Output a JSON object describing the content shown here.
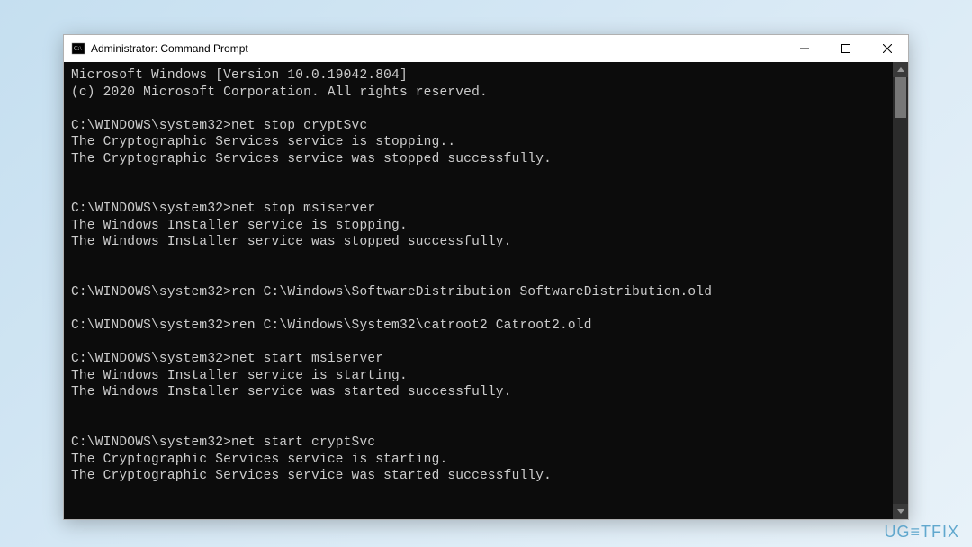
{
  "window": {
    "title": "Administrator: Command Prompt"
  },
  "console": {
    "lines": [
      "Microsoft Windows [Version 10.0.19042.804]",
      "(c) 2020 Microsoft Corporation. All rights reserved.",
      "",
      "C:\\WINDOWS\\system32>net stop cryptSvc",
      "The Cryptographic Services service is stopping..",
      "The Cryptographic Services service was stopped successfully.",
      "",
      "",
      "C:\\WINDOWS\\system32>net stop msiserver",
      "The Windows Installer service is stopping.",
      "The Windows Installer service was stopped successfully.",
      "",
      "",
      "C:\\WINDOWS\\system32>ren C:\\Windows\\SoftwareDistribution SoftwareDistribution.old",
      "",
      "C:\\WINDOWS\\system32>ren C:\\Windows\\System32\\catroot2 Catroot2.old",
      "",
      "C:\\WINDOWS\\system32>net start msiserver",
      "The Windows Installer service is starting.",
      "The Windows Installer service was started successfully.",
      "",
      "",
      "C:\\WINDOWS\\system32>net start cryptSvc",
      "The Cryptographic Services service is starting.",
      "The Cryptographic Services service was started successfully."
    ]
  },
  "watermark": {
    "text": "UG≡TFIX"
  }
}
